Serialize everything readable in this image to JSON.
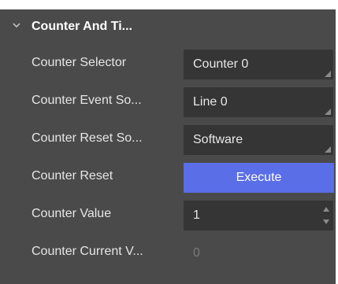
{
  "group": {
    "title": "Counter And Ti...",
    "icon": "chevron-down-icon"
  },
  "rows": [
    {
      "label": "Counter Selector",
      "value": "Counter 0"
    },
    {
      "label": "Counter Event So...",
      "value": "Line 0"
    },
    {
      "label": "Counter Reset So...",
      "value": "Software"
    },
    {
      "label": "Counter Reset",
      "button": "Execute"
    },
    {
      "label": "Counter Value",
      "value": "1"
    },
    {
      "label": "Counter Current V...",
      "value": "0"
    }
  ],
  "colors": {
    "panel": "#4a4a4a",
    "field": "#353535",
    "accent": "#5a6ee8"
  }
}
